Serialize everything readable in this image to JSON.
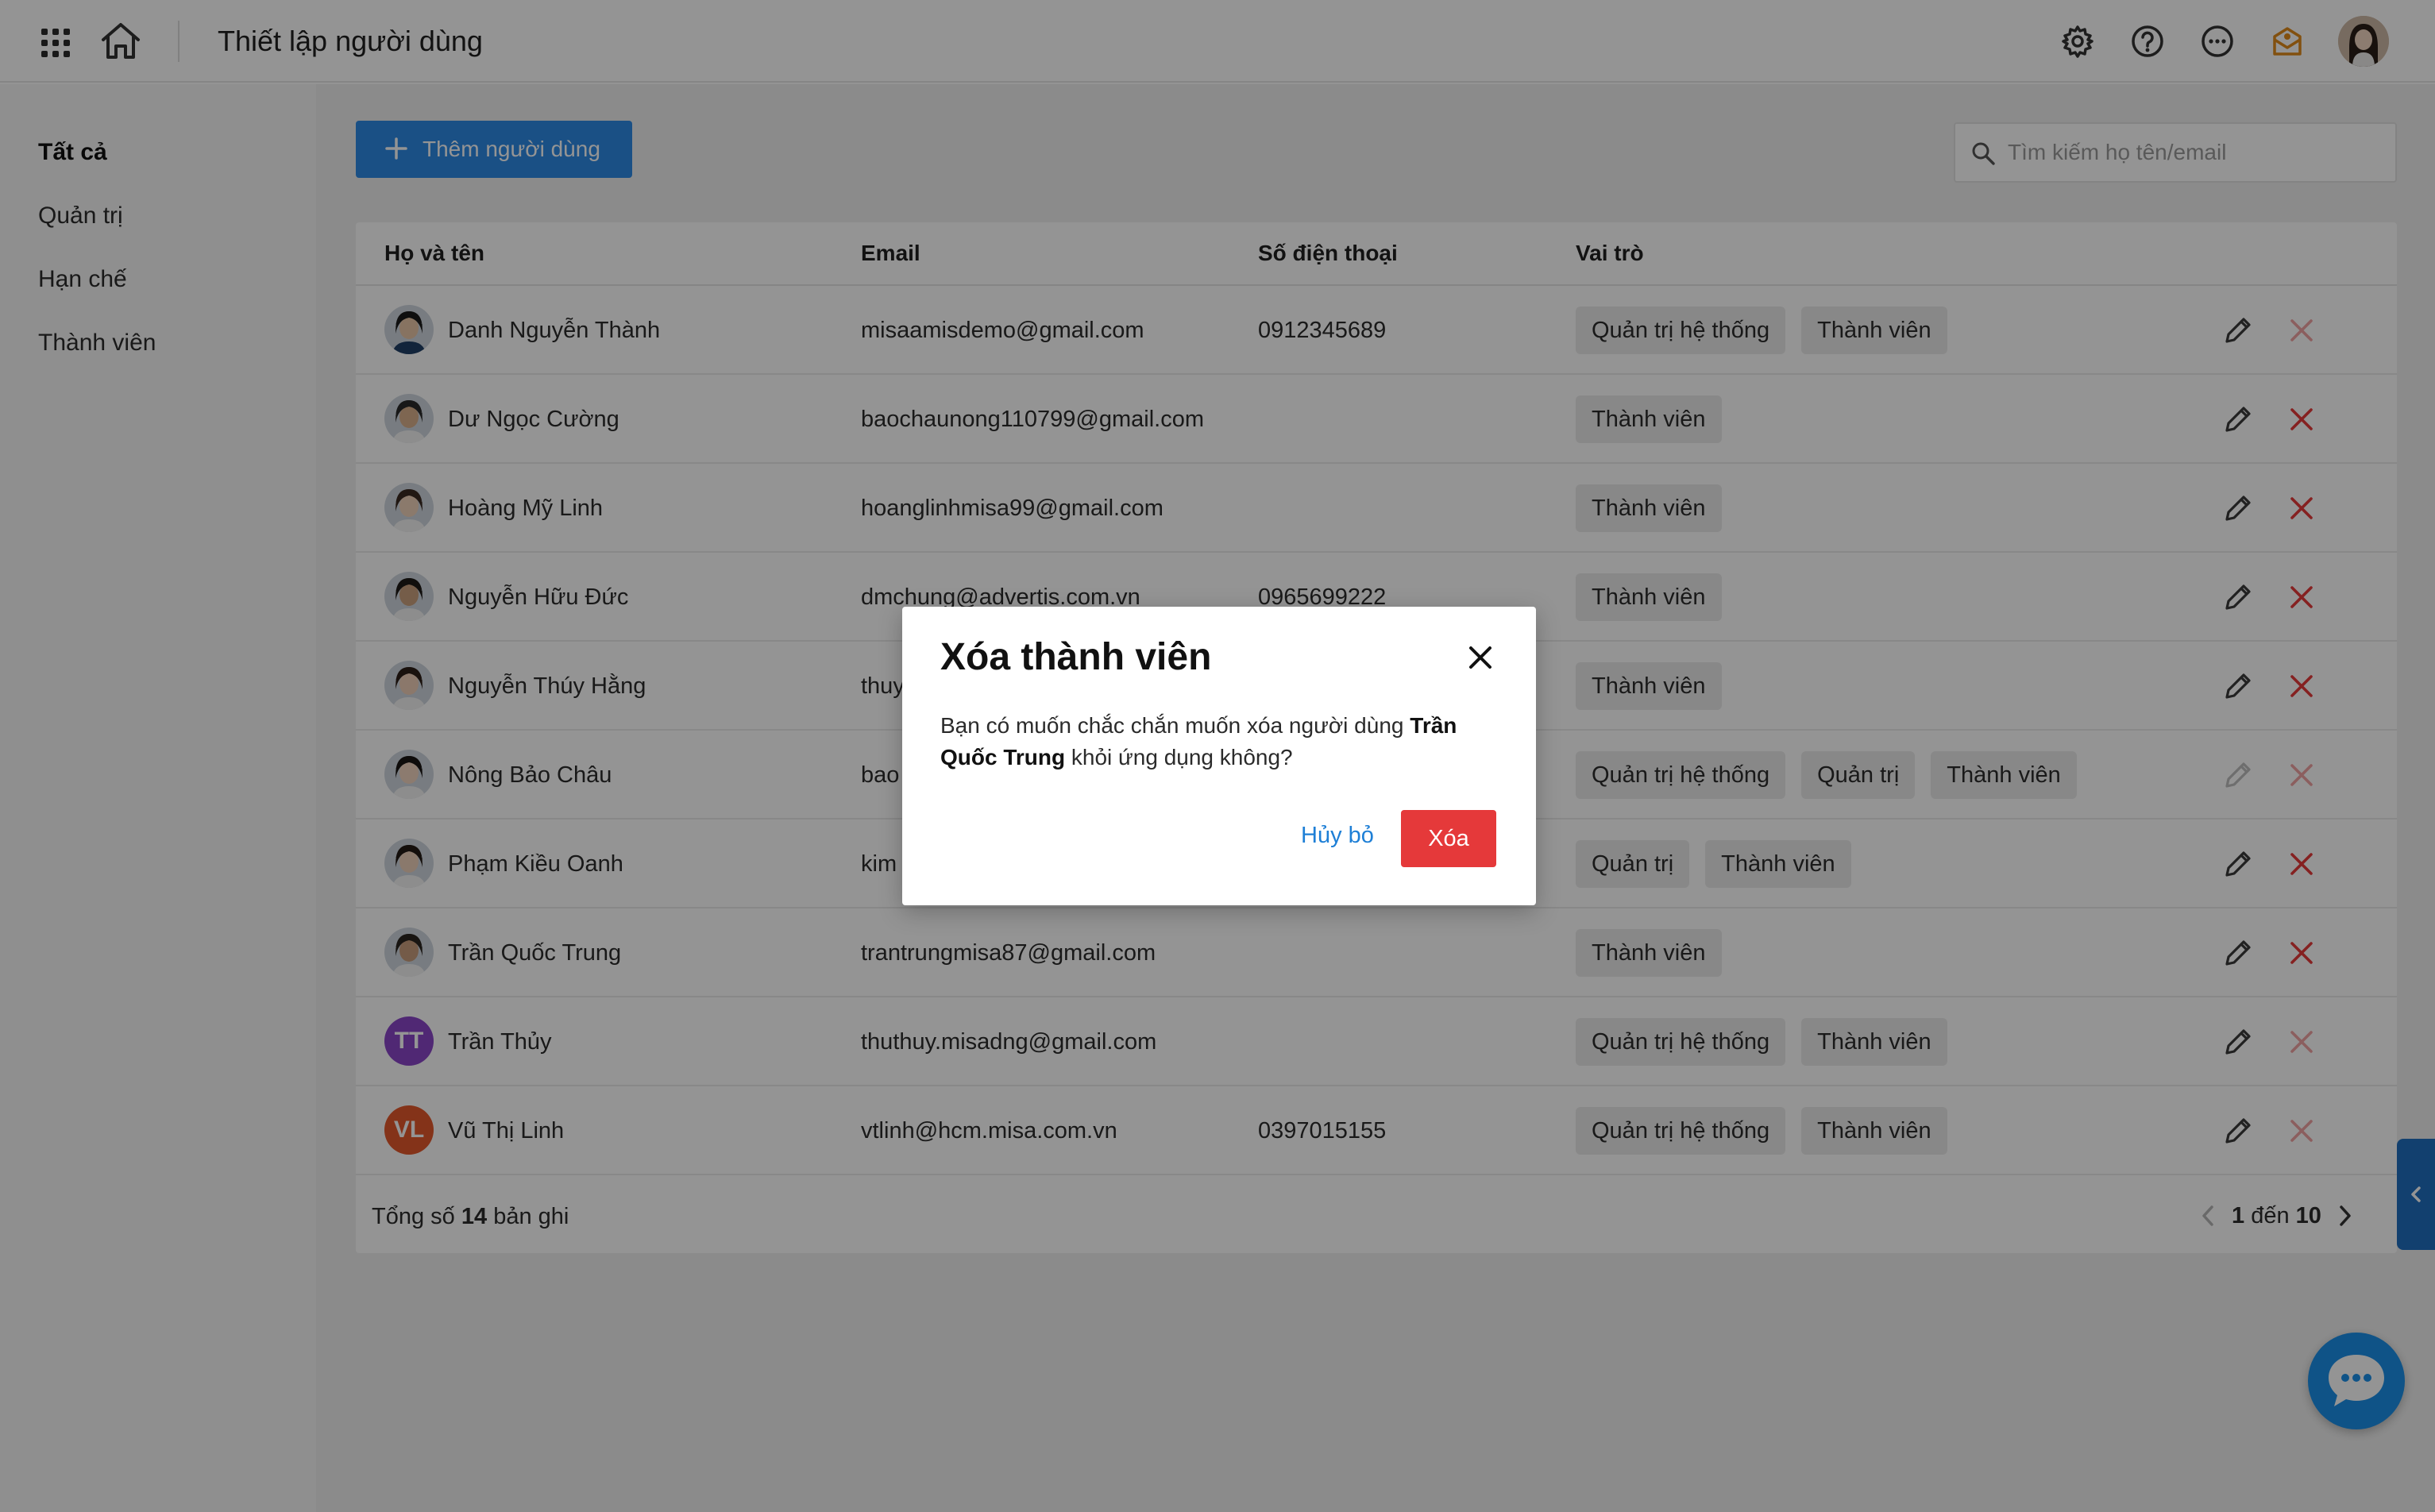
{
  "header": {
    "title": "Thiết lập người dùng",
    "icons": [
      "apps-grid-icon",
      "home-icon",
      "settings-icon",
      "help-icon",
      "more-icon",
      "notification-icon",
      "user-avatar"
    ]
  },
  "sidebar": {
    "items": [
      {
        "label": "Tất cả",
        "active": true
      },
      {
        "label": "Quản trị"
      },
      {
        "label": "Hạn chế"
      },
      {
        "label": "Thành viên"
      }
    ]
  },
  "toolbar": {
    "add_label": "Thêm người dùng",
    "search_placeholder": "Tìm kiếm họ tên/email"
  },
  "table": {
    "columns": [
      "Họ và tên",
      "Email",
      "Số điện thoại",
      "Vai trò"
    ],
    "rows": [
      {
        "name": "Danh Nguyễn Thành",
        "email": "misaamisdemo@gmail.com",
        "phone": "0912345689",
        "roles": [
          "Quản trị hệ thống",
          "Thành viên"
        ],
        "avatar": "photo",
        "delete_enabled": false
      },
      {
        "name": "Dư Ngọc Cường",
        "email": "baochaunong110799@gmail.com",
        "phone": "",
        "roles": [
          "Thành viên"
        ],
        "avatar": "photo",
        "delete_enabled": true
      },
      {
        "name": "Hoàng Mỹ Linh",
        "email": "hoanglinhmisa99@gmail.com",
        "phone": "",
        "roles": [
          "Thành viên"
        ],
        "avatar": "photo",
        "delete_enabled": true
      },
      {
        "name": "Nguyễn Hữu Đức",
        "email": "dmchung@advertis.com.vn",
        "phone": "0965699222",
        "roles": [
          "Thành viên"
        ],
        "avatar": "photo",
        "delete_enabled": true
      },
      {
        "name": "Nguyễn Thúy Hằng",
        "email": "thuy",
        "phone": "",
        "roles": [
          "Thành viên"
        ],
        "avatar": "photo",
        "delete_enabled": true
      },
      {
        "name": "Nông Bảo Châu",
        "email": "bao",
        "phone": "",
        "roles": [
          "Quản trị hệ thống",
          "Quản trị",
          "Thành viên"
        ],
        "avatar": "photo",
        "delete_enabled": false
      },
      {
        "name": "Phạm Kiều Oanh",
        "email": "kim",
        "phone": "",
        "roles": [
          "Quản trị",
          "Thành viên"
        ],
        "avatar": "photo",
        "delete_enabled": true
      },
      {
        "name": "Trần Quốc Trung",
        "email": "trantrungmisa87@gmail.com",
        "phone": "",
        "roles": [
          "Thành viên"
        ],
        "avatar": "photo",
        "delete_enabled": true
      },
      {
        "name": "Trần Thủy",
        "email": "thuthuy.misadng@gmail.com",
        "phone": "",
        "roles": [
          "Quản trị hệ thống",
          "Thành viên"
        ],
        "avatar": "initials",
        "initials": "TT",
        "avatar_color": "#8a45c8",
        "delete_enabled": false
      },
      {
        "name": "Vũ Thị Linh",
        "email": "vtlinh@hcm.misa.com.vn",
        "phone": "0397015155",
        "roles": [
          "Quản trị hệ thống",
          "Thành viên"
        ],
        "avatar": "initials",
        "initials": "VL",
        "avatar_color": "#e4582b",
        "delete_enabled": false
      }
    ]
  },
  "footer": {
    "total_prefix": "Tổng số",
    "total_count": "14",
    "total_suffix": "bản ghi",
    "page_from": "1",
    "page_word": "đến",
    "page_to": "10"
  },
  "modal": {
    "title": "Xóa thành viên",
    "text_before": "Bạn có muốn chắc chắn muốn xóa người dùng",
    "user_name": "Trần Quốc Trung",
    "text_after": "khỏi ứng dụng không?",
    "cancel_label": "Hủy bỏ",
    "confirm_label": "Xóa"
  },
  "colors": {
    "primary": "#2e8ae6",
    "danger": "#e5393a",
    "link": "#1e7fd6"
  }
}
